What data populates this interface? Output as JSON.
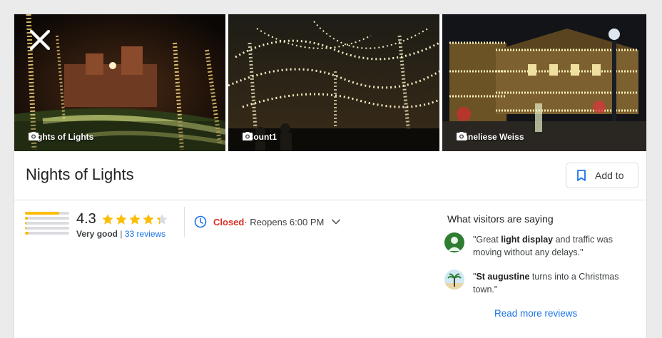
{
  "place": {
    "name": "Nights of Lights",
    "add_label": "Add to"
  },
  "photos": [
    {
      "credit": "Nights of Lights"
    },
    {
      "credit": "JCount1"
    },
    {
      "credit": "Anneliese Weiss"
    }
  ],
  "icons": {
    "close": "close-icon",
    "camera": "camera-icon",
    "bookmark": "bookmark-icon",
    "clock": "clock-icon",
    "chevron": "chevron-down-icon"
  },
  "rating": {
    "value": "4.3",
    "stars_filled": 4.3,
    "label": "Very good",
    "separator": "|",
    "reviews_link": "33 reviews",
    "distribution": [
      0.78,
      0.06,
      0.04,
      0.04,
      0.08
    ]
  },
  "hours": {
    "status": "Closed",
    "detail": " · Reopens 6:00 PM"
  },
  "visitors": {
    "title": "What visitors are saying",
    "reviews": [
      {
        "open": "\"Great ",
        "highlight": "light display",
        "close": " and traffic was moving without any delays.\""
      },
      {
        "open": "\"",
        "highlight": "St augustine",
        "close": " turns into a Christmas town.\""
      }
    ],
    "read_more": "Read more reviews"
  },
  "colors": {
    "accent": "#1a73e8",
    "closed": "#d93025",
    "star": "#fbbc04",
    "star_empty": "#dadce0"
  }
}
